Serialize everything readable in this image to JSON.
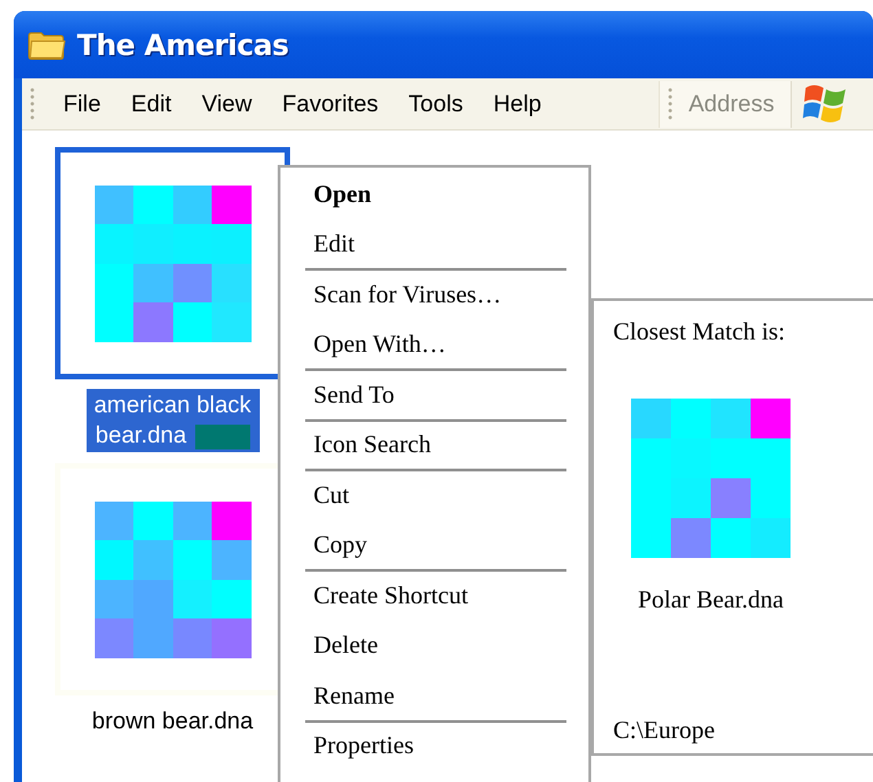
{
  "window": {
    "title": "The Americas"
  },
  "menu_bar": {
    "items": [
      "File",
      "Edit",
      "View",
      "Favorites",
      "Tools",
      "Help"
    ],
    "address_label": "Address"
  },
  "files": [
    {
      "name": "american black bear.dna",
      "selected": true,
      "cells": [
        {
          "color": "#40c0ff"
        },
        {
          "color": "#00ffff"
        },
        {
          "color": "#33ccff"
        },
        {
          "color": "#ff00ff"
        },
        {
          "color": "#08f4ff"
        },
        {
          "color": "#10eeff"
        },
        {
          "color": "#0af2ff"
        },
        {
          "color": "#0cf0ff"
        },
        {
          "color": "#00ffff"
        },
        {
          "color": "#40c0ff"
        },
        {
          "color": "#7090ff"
        },
        {
          "color": "#28e0ff"
        },
        {
          "color": "#00ffff"
        },
        {
          "color": "#8c78ff"
        },
        {
          "color": "#00ffff"
        },
        {
          "color": "#20e8ff"
        }
      ]
    },
    {
      "name": "brown bear.dna",
      "selected": false,
      "cells": [
        {
          "color": "#4cb4ff"
        },
        {
          "color": "#00ffff"
        },
        {
          "color": "#4cb4ff"
        },
        {
          "color": "#ff00ff"
        },
        {
          "color": "#00f8ff"
        },
        {
          "color": "#40c0ff"
        },
        {
          "color": "#00ffff"
        },
        {
          "color": "#4cb4ff"
        },
        {
          "color": "#4cb4ff"
        },
        {
          "color": "#50a8ff"
        },
        {
          "color": "#14f0ff"
        },
        {
          "color": "#00ffff"
        },
        {
          "color": "#7c88ff"
        },
        {
          "color": "#50a8ff"
        },
        {
          "color": "#7888ff"
        },
        {
          "color": "#9470ff"
        }
      ]
    }
  ],
  "context_menu": {
    "items": [
      {
        "label": "Open",
        "default": true,
        "separator_after": false
      },
      {
        "label": "Edit",
        "default": false,
        "separator_after": true
      },
      {
        "label": "Scan for Viruses…",
        "default": false,
        "separator_after": false
      },
      {
        "label": "Open With…",
        "default": false,
        "separator_after": true
      },
      {
        "label": "Send To",
        "default": false,
        "separator_after": true
      },
      {
        "label": "Icon Search",
        "default": false,
        "separator_after": true
      },
      {
        "label": "Cut",
        "default": false,
        "separator_after": false
      },
      {
        "label": "Copy",
        "default": false,
        "separator_after": true
      },
      {
        "label": "Create Shortcut",
        "default": false,
        "separator_after": false
      },
      {
        "label": "Delete",
        "default": false,
        "separator_after": false
      },
      {
        "label": "Rename",
        "default": false,
        "separator_after": true
      },
      {
        "label": "Properties",
        "default": false,
        "separator_after": false
      }
    ]
  },
  "match_panel": {
    "heading": "Closest Match is:",
    "file": {
      "name": "Polar Bear.dna",
      "cells": [
        {
          "color": "#28d8ff"
        },
        {
          "color": "#00ffff"
        },
        {
          "color": "#20e4ff"
        },
        {
          "color": "#ff00ff"
        },
        {
          "color": "#00ffff"
        },
        {
          "color": "#08f8ff"
        },
        {
          "color": "#00ffff"
        },
        {
          "color": "#00ffff"
        },
        {
          "color": "#00ffff"
        },
        {
          "color": "#0cf4ff"
        },
        {
          "color": "#8880ff"
        },
        {
          "color": "#00ffff"
        },
        {
          "color": "#00ffff"
        },
        {
          "color": "#7c88ff"
        },
        {
          "color": "#00ffff"
        },
        {
          "color": "#14ecff"
        }
      ]
    },
    "path": "C:\\Europe"
  }
}
